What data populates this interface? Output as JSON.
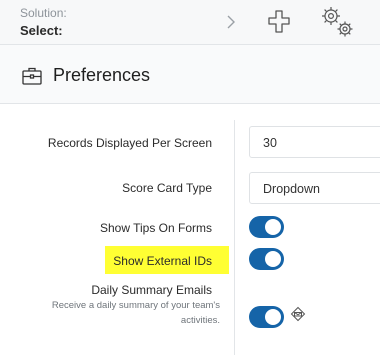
{
  "header": {
    "solution_label": "Solution:",
    "solution_value": "Select:",
    "icons": [
      "chevron-right-icon",
      "add-icon",
      "settings-gears-icon"
    ]
  },
  "preferences": {
    "title": "Preferences",
    "title_icon": "briefcase-icon"
  },
  "settings": {
    "records_label": "Records Displayed Per Screen",
    "records_value": "30",
    "scorecard_label": "Score Card Type",
    "scorecard_value": "Dropdown",
    "tips_label": "Show Tips On Forms",
    "tips_on": true,
    "external_ids_label": "Show External IDs",
    "external_ids_on": true,
    "summary_label": "Daily Summary Emails",
    "summary_desc_line1": "Receive a daily summary of your team's",
    "summary_desc_line2": "activities.",
    "summary_on": true
  },
  "colors": {
    "toggle_on": "#1564a8",
    "highlight": "#ffff33"
  }
}
